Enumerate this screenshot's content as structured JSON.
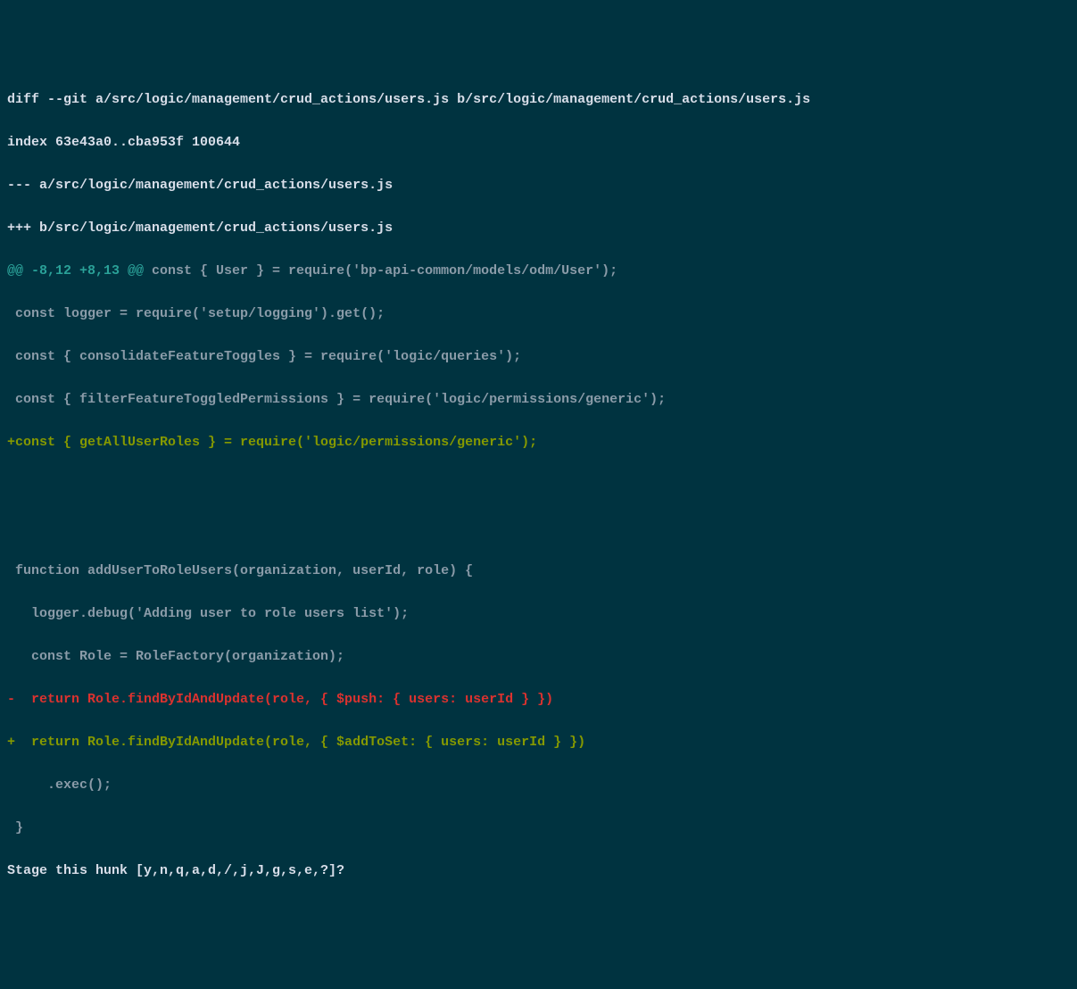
{
  "diff": {
    "header": "diff --git a/src/logic/management/crud_actions/users.js b/src/logic/management/crud_actions/users.js",
    "index": "index 63e43a0..cba953f 100644",
    "fileA": "--- a/src/logic/management/crud_actions/users.js",
    "fileB": "+++ b/src/logic/management/crud_actions/users.js",
    "hunk_marker": "@@ -8,12 +8,13 @@",
    "hunk_context": " const { User } = require('bp-api-common/models/odm/User');",
    "lines": {
      "ctx1": " const logger = require('setup/logging').get();",
      "ctx2": " const { consolidateFeatureToggles } = require('logic/queries');",
      "ctx3": " const { filterFeatureToggledPermissions } = require('logic/permissions/generic');",
      "add1": "+const { getAllUserRoles } = require('logic/permissions/generic');",
      "blank1": " ",
      "blank2": " ",
      "ctx4": " function addUserToRoleUsers(organization, userId, role) {",
      "ctx5": "   logger.debug('Adding user to role users list');",
      "ctx6": "   const Role = RoleFactory(organization);",
      "del1": "-  return Role.findByIdAndUpdate(role, { $push: { users: userId } })",
      "add2": "+  return Role.findByIdAndUpdate(role, { $addToSet: { users: userId } })",
      "ctx7": "     .exec();",
      "ctx8": " }"
    },
    "prompt": "Stage this hunk [y,n,q,a,d,/,j,J,g,s,e,?]? "
  }
}
